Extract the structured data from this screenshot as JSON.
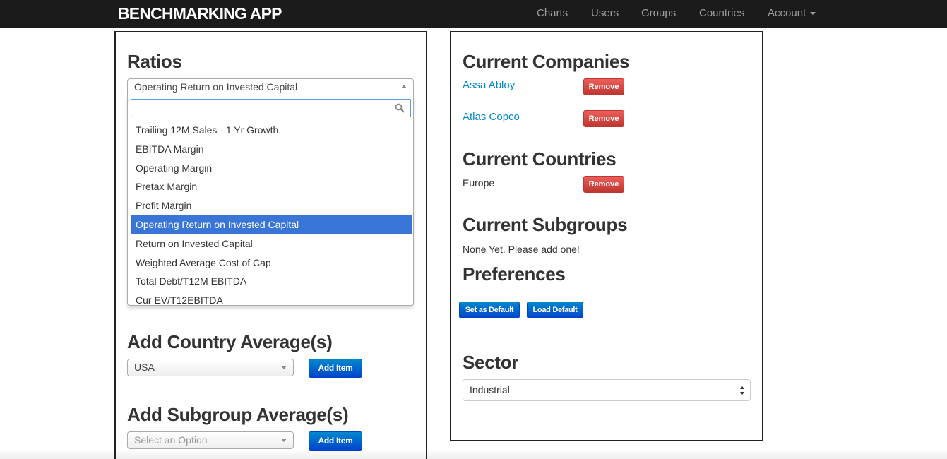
{
  "navbar": {
    "brand": "BENCHMARKING APP",
    "items": [
      "Charts",
      "Users",
      "Groups",
      "Countries",
      "Account"
    ]
  },
  "ratios": {
    "heading": "Ratios",
    "selected": "Operating Return on Invested Capital",
    "search_value": "",
    "options": [
      "Trailing 12M Sales - 1 Yr Growth",
      "EBITDA Margin",
      "Operating Margin",
      "Pretax Margin",
      "Profit Margin",
      "Operating Return on Invested Capital",
      "Return on Invested Capital",
      "Weighted Average Cost of Cap",
      "Total Debt/T12M EBITDA",
      "Cur EV/T12EBITDA"
    ],
    "highlighted_option": "Operating Return on Invested Capital"
  },
  "country_avg": {
    "heading": "Add Country Average(s)",
    "selected": "USA",
    "add_label": "Add Item"
  },
  "subgroup_avg": {
    "heading": "Add Subgroup Average(s)",
    "placeholder": "Select an Option",
    "add_label": "Add Item"
  },
  "companies": {
    "heading": "Current Companies",
    "items": [
      {
        "name": "Assa Abloy",
        "remove_label": "Remove"
      },
      {
        "name": "Atlas Copco",
        "remove_label": "Remove"
      }
    ]
  },
  "countries": {
    "heading": "Current Countries",
    "items": [
      {
        "name": "Europe",
        "remove_label": "Remove"
      }
    ]
  },
  "subgroups": {
    "heading": "Current Subgroups",
    "empty_text": "None Yet. Please add one!"
  },
  "preferences": {
    "heading": "Preferences",
    "set_default_label": "Set as Default",
    "load_default_label": "Load Default"
  },
  "sector": {
    "heading": "Sector",
    "selected": "Industrial"
  },
  "colors": {
    "navbar_bg": "#1b1b1b",
    "primary": "#0044cc",
    "danger": "#bd362f",
    "link": "#0088cc",
    "highlight": "#3875d7"
  }
}
